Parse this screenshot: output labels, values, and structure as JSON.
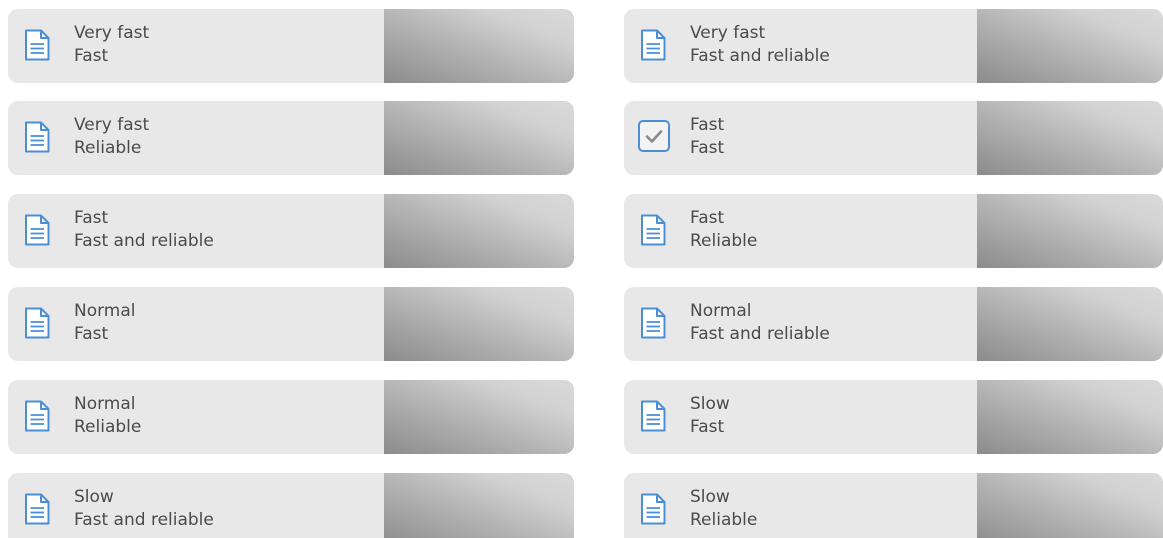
{
  "colors": {
    "tile_background": "#e8e8e8",
    "text": "#4a4a4a",
    "icon_accent": "#4a8fd6"
  },
  "left_column": [
    {
      "line1": "Very fast",
      "line2": "Fast",
      "icon": "document-icon"
    },
    {
      "line1": "Very fast",
      "line2": "Reliable",
      "icon": "document-icon"
    },
    {
      "line1": "Fast",
      "line2": "Fast and reliable",
      "icon": "document-icon"
    },
    {
      "line1": "Normal",
      "line2": "Fast",
      "icon": "document-icon"
    },
    {
      "line1": "Normal",
      "line2": "Reliable",
      "icon": "document-icon"
    },
    {
      "line1": "Slow",
      "line2": "Fast and reliable",
      "icon": "document-icon"
    }
  ],
  "right_column": [
    {
      "line1": "Very fast",
      "line2": "Fast and reliable",
      "icon": "document-icon"
    },
    {
      "line1": "Fast",
      "line2": "Fast",
      "icon": "checkbox-checked-icon"
    },
    {
      "line1": "Fast",
      "line2": "Reliable",
      "icon": "document-icon"
    },
    {
      "line1": "Normal",
      "line2": "Fast and reliable",
      "icon": "document-icon"
    },
    {
      "line1": "Slow",
      "line2": "Fast",
      "icon": "document-icon"
    },
    {
      "line1": "Slow",
      "line2": "Reliable",
      "icon": "document-icon"
    }
  ]
}
